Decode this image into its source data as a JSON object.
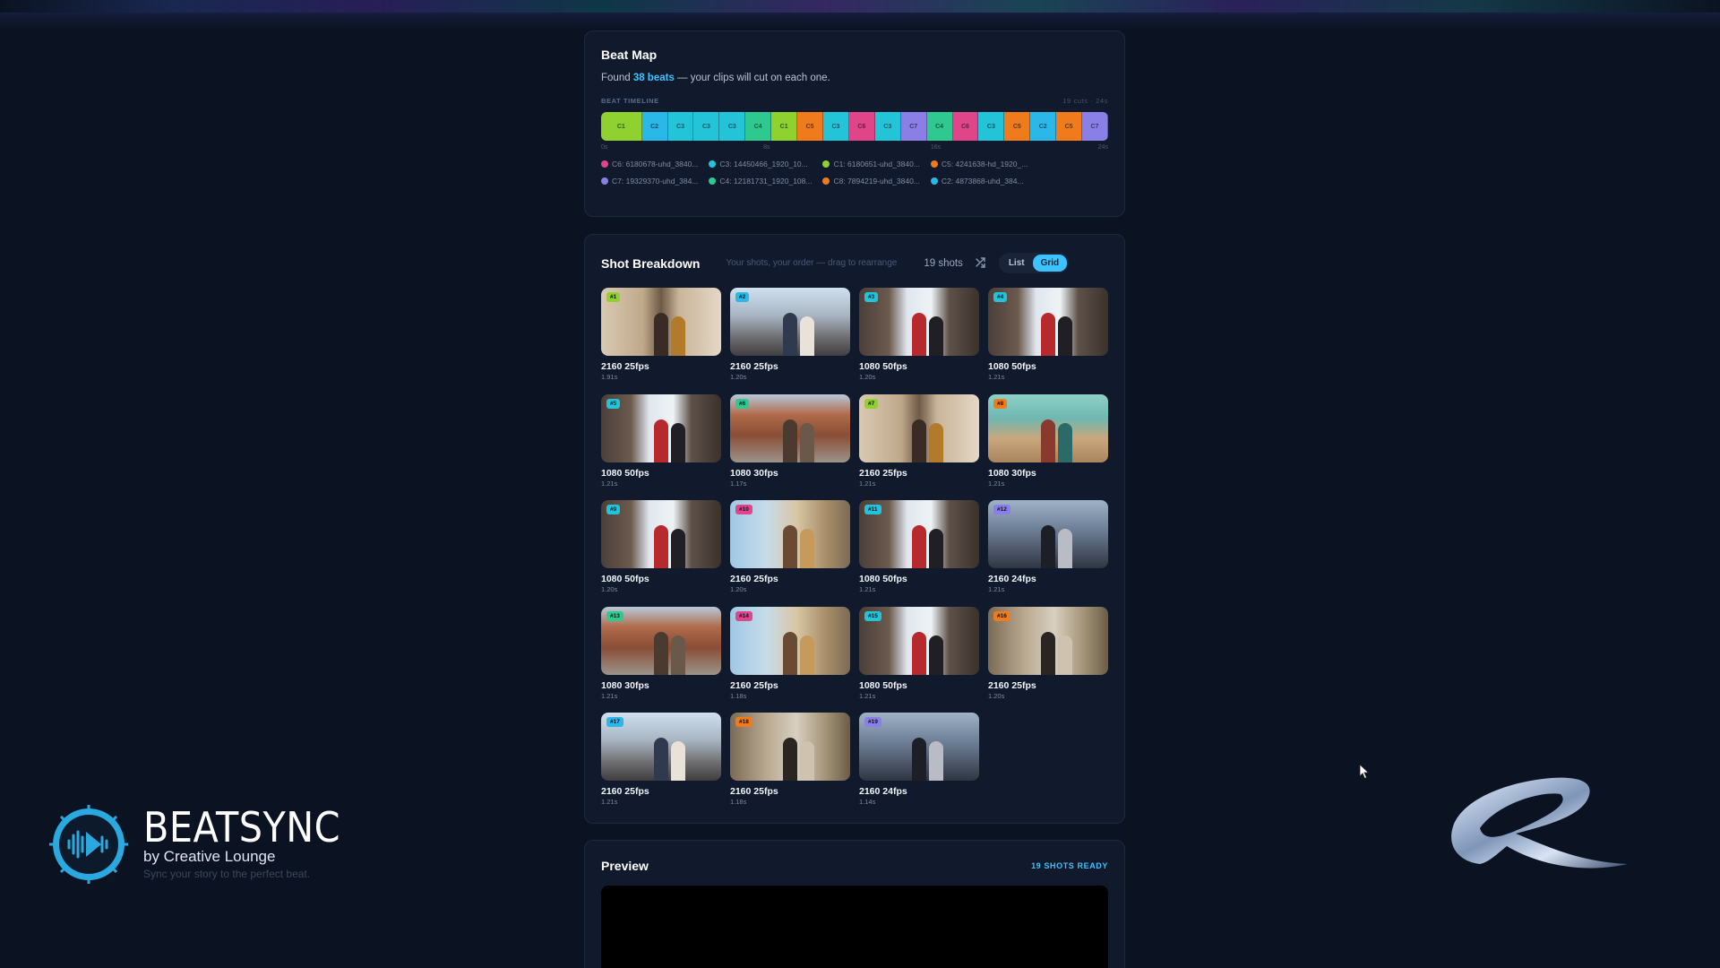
{
  "beat_map": {
    "title": "Beat Map",
    "found_prefix": "Found",
    "found_beats": "38 beats",
    "found_suffix": "— your clips will cut on each one.",
    "timeline_label": "BEAT TIMELINE",
    "timeline_meta": "19 cuts · 24s",
    "segments": [
      {
        "label": "C1",
        "color": "#8fd12e"
      },
      {
        "label": "C2",
        "color": "#29b8e8"
      },
      {
        "label": "C3",
        "color": "#23c3d8"
      },
      {
        "label": "C3",
        "color": "#23c3d8"
      },
      {
        "label": "C3",
        "color": "#23c3d8"
      },
      {
        "label": "C4",
        "color": "#2fc98f"
      },
      {
        "label": "C1",
        "color": "#8fd12e"
      },
      {
        "label": "C5",
        "color": "#f07b1c"
      },
      {
        "label": "C3",
        "color": "#23c3d8"
      },
      {
        "label": "C6",
        "color": "#e0458a"
      },
      {
        "label": "C3",
        "color": "#23c3d8"
      },
      {
        "label": "C7",
        "color": "#8a7fe6"
      },
      {
        "label": "C4",
        "color": "#2fc98f"
      },
      {
        "label": "C6",
        "color": "#e0458a"
      },
      {
        "label": "C3",
        "color": "#23c3d8"
      },
      {
        "label": "C5",
        "color": "#f07b1c"
      },
      {
        "label": "C2",
        "color": "#29b8e8"
      },
      {
        "label": "C5",
        "color": "#f07b1c"
      },
      {
        "label": "C7",
        "color": "#8a7fe6"
      }
    ],
    "ticks": [
      "0s",
      "8s",
      "16s",
      "24s"
    ],
    "legend": [
      {
        "text": "C6: 6180678-uhd_3840...",
        "color": "#e0458a"
      },
      {
        "text": "C3: 14450466_1920_10...",
        "color": "#23c3d8"
      },
      {
        "text": "C1: 6180651-uhd_3840...",
        "color": "#8fd12e"
      },
      {
        "text": "C5: 4241638-hd_1920_...",
        "color": "#f07b1c"
      },
      {
        "text": "C7: 19329370-uhd_384...",
        "color": "#8a7fe6"
      },
      {
        "text": "C4: 12181731_1920_108...",
        "color": "#2fc98f"
      },
      {
        "text": "C8: 7894219-uhd_3840...",
        "color": "#f07b1c"
      },
      {
        "text": "C2: 4873868-uhd_384...",
        "color": "#29b8e8"
      }
    ]
  },
  "shot_breakdown": {
    "title": "Shot Breakdown",
    "subtitle": "Your shots, your order — drag to rearrange",
    "count": "19 shots",
    "view_list": "List",
    "view_grid": "Grid",
    "shots": [
      {
        "badge": "#1",
        "badge_color": "#8fd12e",
        "res": "2160 25fps",
        "dur": "1.91s",
        "scene": "street"
      },
      {
        "badge": "#2",
        "badge_color": "#29b8e8",
        "res": "2160 25fps",
        "dur": "1.20s",
        "scene": "market"
      },
      {
        "badge": "#3",
        "badge_color": "#23c3d8",
        "res": "1080 50fps",
        "dur": "1.20s",
        "scene": "door"
      },
      {
        "badge": "#4",
        "badge_color": "#23c3d8",
        "res": "1080 50fps",
        "dur": "1.21s",
        "scene": "door"
      },
      {
        "badge": "#5",
        "badge_color": "#23c3d8",
        "res": "1080 50fps",
        "dur": "1.21s",
        "scene": "door"
      },
      {
        "badge": "#6",
        "badge_color": "#2fc98f",
        "res": "1080 30fps",
        "dur": "1.17s",
        "scene": "alley"
      },
      {
        "badge": "#7",
        "badge_color": "#8fd12e",
        "res": "2160 25fps",
        "dur": "1.21s",
        "scene": "street"
      },
      {
        "badge": "#8",
        "badge_color": "#f07b1c",
        "res": "1080 30fps",
        "dur": "1.21s",
        "scene": "bridge"
      },
      {
        "badge": "#9",
        "badge_color": "#23c3d8",
        "res": "1080 50fps",
        "dur": "1.20s",
        "scene": "door"
      },
      {
        "badge": "#10",
        "badge_color": "#e0458a",
        "res": "2160 25fps",
        "dur": "1.20s",
        "scene": "portrait"
      },
      {
        "badge": "#11",
        "badge_color": "#23c3d8",
        "res": "1080 50fps",
        "dur": "1.21s",
        "scene": "door"
      },
      {
        "badge": "#12",
        "badge_color": "#8a7fe6",
        "res": "2160 24fps",
        "dur": "1.21s",
        "scene": "city"
      },
      {
        "badge": "#13",
        "badge_color": "#2fc98f",
        "res": "1080 30fps",
        "dur": "1.21s",
        "scene": "alley"
      },
      {
        "badge": "#14",
        "badge_color": "#e0458a",
        "res": "2160 25fps",
        "dur": "1.18s",
        "scene": "portrait"
      },
      {
        "badge": "#15",
        "badge_color": "#23c3d8",
        "res": "1080 50fps",
        "dur": "1.21s",
        "scene": "door"
      },
      {
        "badge": "#16",
        "badge_color": "#f07b1c",
        "res": "2160 25fps",
        "dur": "1.20s",
        "scene": "tram"
      },
      {
        "badge": "#17",
        "badge_color": "#29b8e8",
        "res": "2160 25fps",
        "dur": "1.21s",
        "scene": "market"
      },
      {
        "badge": "#18",
        "badge_color": "#f07b1c",
        "res": "2160 25fps",
        "dur": "1.18s",
        "scene": "tram"
      },
      {
        "badge": "#19",
        "badge_color": "#8a7fe6",
        "res": "2160 24fps",
        "dur": "1.14s",
        "scene": "city"
      }
    ]
  },
  "preview": {
    "title": "Preview",
    "status": "19 SHOTS READY"
  },
  "brand": {
    "name": "BEATSYNC",
    "by": "by Creative Lounge",
    "tagline": "Sync your story to the perfect beat."
  },
  "icons": {
    "shuffle": "shuffle-icon",
    "logo": "waveform-play-logo",
    "cursor": "mouse-cursor-icon"
  },
  "colors": {
    "accent": "#3cc3ff",
    "background": "#0b1322",
    "card": "#111a2c"
  }
}
